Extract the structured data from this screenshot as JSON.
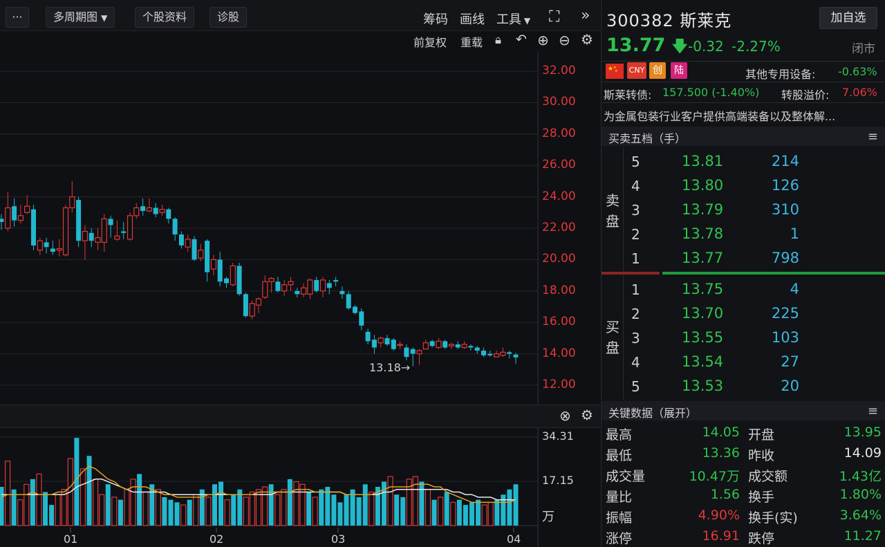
{
  "toolbar": {
    "more": "···",
    "multi_period": "多周期图",
    "profile": "个股资料",
    "diagnose": "诊股",
    "chips": "筹码",
    "draw": "画线",
    "tools": "工具",
    "expand_icon": "expand-icon",
    "collapse_icon": "double-chevron-right-icon",
    "adjust": "前复权",
    "reload": "重载"
  },
  "chart_data": [
    {
      "type": "candlestick",
      "y_ticks": [
        "32.00",
        "30.00",
        "28.00",
        "26.00",
        "24.00",
        "22.00",
        "20.00",
        "18.00",
        "16.00",
        "14.00",
        "12.00"
      ],
      "ylim": [
        11.5,
        32.5
      ],
      "low_annotation": "13.18→",
      "candles": [
        [
          22.6,
          22.4,
          22.9,
          21.9
        ],
        [
          22.0,
          23.3,
          24.3,
          21.8
        ],
        [
          23.4,
          22.5,
          23.9,
          22.1
        ],
        [
          22.5,
          22.8,
          23.5,
          22.3
        ],
        [
          23.0,
          23.4,
          24.1,
          22.9
        ],
        [
          23.2,
          20.9,
          23.5,
          20.6
        ],
        [
          20.6,
          21.2,
          21.4,
          20.3
        ],
        [
          21.1,
          20.8,
          21.4,
          20.4
        ],
        [
          20.7,
          20.5,
          21.2,
          20.3
        ],
        [
          20.6,
          20.7,
          21.3,
          20.2
        ],
        [
          20.3,
          23.3,
          23.5,
          20.2
        ],
        [
          23.3,
          24.0,
          25.0,
          23.0
        ],
        [
          23.8,
          21.2,
          24.0,
          20.8
        ],
        [
          21.2,
          21.8,
          22.2,
          20.0
        ],
        [
          21.7,
          21.2,
          22.0,
          20.8
        ],
        [
          21.1,
          21.4,
          22.0,
          20.6
        ],
        [
          21.1,
          22.6,
          22.9,
          20.5
        ],
        [
          22.6,
          22.2,
          22.8,
          21.4
        ],
        [
          21.3,
          21.5,
          22.5,
          21.2
        ],
        [
          21.8,
          21.7,
          22.4,
          21.3
        ],
        [
          21.3,
          22.8,
          23.0,
          21.2
        ],
        [
          22.8,
          23.3,
          23.6,
          22.6
        ],
        [
          23.4,
          23.1,
          23.9,
          22.8
        ],
        [
          23.1,
          23.3,
          23.9,
          23.0
        ],
        [
          23.3,
          22.9,
          23.6,
          22.7
        ],
        [
          23.0,
          23.2,
          23.5,
          22.8
        ],
        [
          23.2,
          22.6,
          23.3,
          22.3
        ],
        [
          22.6,
          21.6,
          22.7,
          21.2
        ],
        [
          21.6,
          20.9,
          21.8,
          20.7
        ],
        [
          20.8,
          21.3,
          21.6,
          20.5
        ],
        [
          21.3,
          20.0,
          21.5,
          19.9
        ],
        [
          20.1,
          20.6,
          21.0,
          19.9
        ],
        [
          21.2,
          19.2,
          21.3,
          18.6
        ],
        [
          19.4,
          20.0,
          20.3,
          19.0
        ],
        [
          20.0,
          18.6,
          20.5,
          18.3
        ],
        [
          18.8,
          18.5,
          18.9,
          18.2
        ],
        [
          18.4,
          19.6,
          19.8,
          18.3
        ],
        [
          19.6,
          17.8,
          19.8,
          17.7
        ],
        [
          17.8,
          16.4,
          17.9,
          16.3
        ],
        [
          16.4,
          17.2,
          17.4,
          16.2
        ],
        [
          17.1,
          17.5,
          17.6,
          16.6
        ],
        [
          17.6,
          18.6,
          19.0,
          17.5
        ],
        [
          18.6,
          18.8,
          18.9,
          17.9
        ],
        [
          18.6,
          18.0,
          18.9,
          17.9
        ],
        [
          18.0,
          18.4,
          18.7,
          17.7
        ],
        [
          18.4,
          18.6,
          18.9,
          18.0
        ],
        [
          18.0,
          17.8,
          18.2,
          17.6
        ],
        [
          17.8,
          18.2,
          18.5,
          17.6
        ],
        [
          17.8,
          18.7,
          18.8,
          17.5
        ],
        [
          18.7,
          18.0,
          18.9,
          17.9
        ],
        [
          18.0,
          18.7,
          18.9,
          17.6
        ],
        [
          18.5,
          18.2,
          18.7,
          17.8
        ],
        [
          18.7,
          18.6,
          18.9,
          18.3
        ],
        [
          18.0,
          17.8,
          18.3,
          17.5
        ],
        [
          17.8,
          16.9,
          18.0,
          16.8
        ],
        [
          17.0,
          16.6,
          17.1,
          16.5
        ],
        [
          16.7,
          15.8,
          16.9,
          15.5
        ],
        [
          15.4,
          14.8,
          15.6,
          14.6
        ],
        [
          14.9,
          14.4,
          15.2,
          14.0
        ],
        [
          14.7,
          15.0,
          15.1,
          14.4
        ],
        [
          15.0,
          14.6,
          15.2,
          14.5
        ],
        [
          14.9,
          14.3,
          15.0,
          14.2
        ],
        [
          14.6,
          14.6,
          14.8,
          14.3
        ],
        [
          14.4,
          13.8,
          14.6,
          13.6
        ],
        [
          14.3,
          14.0,
          14.4,
          13.2
        ],
        [
          14.0,
          14.2,
          14.3,
          13.3
        ],
        [
          14.3,
          14.7,
          14.9,
          14.3
        ],
        [
          14.8,
          14.5,
          14.9,
          14.4
        ],
        [
          14.4,
          14.8,
          15.0,
          14.3
        ],
        [
          14.8,
          14.4,
          14.9,
          14.3
        ],
        [
          14.5,
          14.6,
          14.7,
          14.3
        ],
        [
          14.6,
          14.4,
          14.8,
          14.3
        ],
        [
          14.4,
          14.6,
          14.8,
          14.3
        ],
        [
          14.5,
          14.4,
          14.6,
          14.2
        ],
        [
          14.4,
          14.2,
          14.5,
          14.0
        ],
        [
          14.2,
          13.9,
          14.4,
          13.8
        ],
        [
          14.0,
          13.9,
          14.2,
          13.8
        ],
        [
          13.8,
          14.0,
          14.2,
          13.8
        ],
        [
          13.9,
          14.1,
          14.4,
          13.8
        ],
        [
          14.1,
          14.0,
          14.2,
          13.7
        ],
        [
          13.95,
          13.77,
          14.05,
          13.36
        ]
      ]
    },
    {
      "type": "bar",
      "y_ticks": [
        "34.31",
        "17.15"
      ],
      "unit_label": "万",
      "x_ticks": [
        "01",
        "02",
        "03",
        "04"
      ],
      "ylim": [
        0,
        34.31
      ],
      "volumes": [
        15,
        25,
        14,
        10,
        16,
        18,
        20,
        13,
        8,
        12,
        14,
        26,
        34,
        22,
        27,
        18,
        12,
        16,
        11,
        10,
        14,
        18,
        20,
        13,
        16,
        14,
        11,
        10,
        9,
        8,
        10,
        12,
        14,
        11,
        16,
        17,
        10,
        12,
        14,
        11,
        13,
        14,
        15,
        16,
        12,
        14,
        18,
        17,
        16,
        13,
        11,
        14,
        15,
        12,
        9,
        12,
        14,
        11,
        16,
        13,
        15,
        17,
        19,
        12,
        11,
        18,
        19,
        17,
        14,
        10,
        11,
        13,
        9,
        10,
        8,
        9,
        10,
        8,
        9,
        10,
        12,
        14,
        16
      ],
      "ma1": [
        11,
        12,
        12,
        12,
        12,
        13,
        12,
        12,
        12,
        13,
        13,
        15,
        18,
        21,
        23,
        22,
        20,
        18,
        17,
        15,
        14,
        15,
        15,
        15,
        14,
        13,
        12,
        12,
        11,
        11,
        11,
        11,
        11,
        12,
        12,
        13,
        12,
        12,
        12,
        12,
        12,
        13,
        13,
        13,
        13,
        13,
        13,
        14,
        14,
        14,
        13,
        13,
        13,
        13,
        13,
        12,
        12,
        12,
        12,
        12,
        13,
        14,
        15,
        15,
        15,
        15,
        16,
        16,
        16,
        15,
        15,
        13,
        12,
        11,
        10,
        9,
        9,
        9,
        9,
        9,
        9,
        9,
        10
      ],
      "ma2": [
        12,
        12,
        12,
        12,
        12,
        12,
        12,
        12,
        12,
        12,
        12,
        13,
        15,
        16,
        17,
        18,
        18,
        17,
        16,
        15,
        14,
        13,
        13,
        13,
        13,
        13,
        13,
        12,
        12,
        12,
        12,
        12,
        12,
        12,
        12,
        12,
        12,
        12,
        12,
        12,
        12,
        12,
        12,
        12,
        13,
        13,
        13,
        13,
        13,
        13,
        13,
        13,
        13,
        13,
        13,
        12,
        12,
        12,
        12,
        12,
        12,
        13,
        13,
        14,
        14,
        14,
        14,
        14,
        14,
        14,
        14,
        14,
        13,
        13,
        12,
        12,
        11,
        11,
        11,
        10,
        10,
        10,
        10
      ]
    }
  ],
  "quote": {
    "code": "300382",
    "name": "斯莱克",
    "add_watch": "加自选",
    "price": "13.77",
    "change": "-0.32",
    "change_pct": "-2.27%",
    "status": "闭市",
    "tags": [
      "CNY",
      "创",
      "陆"
    ],
    "industry": "其他专用设备:",
    "industry_chg": "-0.63%",
    "bond_label": "斯莱转债:",
    "bond_value": "157.500 (-1.40%)",
    "premium_label": "转股溢价:",
    "premium_value": "7.06%",
    "description": "为金属包装行业客户提供高端装备以及整体解..."
  },
  "orderbook": {
    "title": "买卖五档（手）",
    "sell_label": [
      "卖",
      "盘"
    ],
    "buy_label": [
      "买",
      "盘"
    ],
    "sell": [
      {
        "idx": "5",
        "price": "13.81",
        "vol": "214"
      },
      {
        "idx": "4",
        "price": "13.80",
        "vol": "126"
      },
      {
        "idx": "3",
        "price": "13.79",
        "vol": "310"
      },
      {
        "idx": "2",
        "price": "13.78",
        "vol": "1"
      },
      {
        "idx": "1",
        "price": "13.77",
        "vol": "798"
      }
    ],
    "buy": [
      {
        "idx": "1",
        "price": "13.75",
        "vol": "4"
      },
      {
        "idx": "2",
        "price": "13.70",
        "vol": "225"
      },
      {
        "idx": "3",
        "price": "13.55",
        "vol": "103"
      },
      {
        "idx": "4",
        "price": "13.54",
        "vol": "27"
      },
      {
        "idx": "5",
        "price": "13.53",
        "vol": "20"
      }
    ]
  },
  "keydata": {
    "title": "关键数据（展开）",
    "rows": [
      {
        "l": "最高",
        "v": "14.05",
        "vc": "green",
        "l2": "开盘",
        "v2": "13.95",
        "v2c": "green"
      },
      {
        "l": "最低",
        "v": "13.36",
        "vc": "green",
        "l2": "昨收",
        "v2": "14.09",
        "v2c": "white"
      },
      {
        "l": "成交量",
        "v": "10.47万",
        "vc": "green",
        "l2": "成交额",
        "v2": "1.43亿",
        "v2c": "green"
      },
      {
        "l": "量比",
        "v": "1.56",
        "vc": "green",
        "l2": "换手",
        "v2": "1.80%",
        "v2c": "green"
      },
      {
        "l": "振幅",
        "v": "4.90%",
        "vc": "red",
        "l2": "换手(实)",
        "v2": "3.64%",
        "v2c": "green"
      },
      {
        "l": "涨停",
        "v": "16.91",
        "vc": "red",
        "l2": "跌停",
        "v2": "11.27",
        "v2c": "green"
      }
    ]
  }
}
